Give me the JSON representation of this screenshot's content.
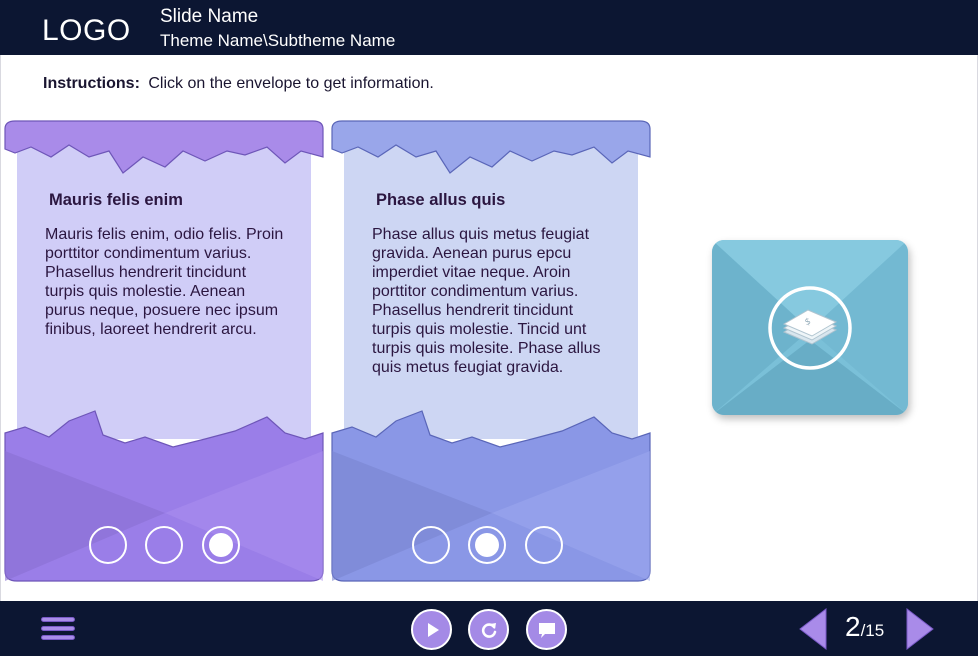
{
  "header": {
    "logo": "LOGO",
    "slide_name": "Slide Name",
    "theme_name": "Theme Name\\Subtheme Name"
  },
  "instructions": {
    "label": "Instructions:",
    "text": "Click on the envelope to get information."
  },
  "cards": [
    {
      "title": "Mauris felis enim",
      "body": "Mauris felis enim, odio felis. Proin porttitor condimentum varius. Phasellus hendrerit tincidunt turpis quis molestie. Aenean purus neque, posuere nec ipsum finibus, laoreet hendrerit arcu.",
      "active_dot": 3,
      "colors": {
        "paper": "#d0cdf7",
        "front": "#9a7ee8",
        "front_dark": "#8a70d2",
        "flap": "#a98be9"
      }
    },
    {
      "title": "Phase allus quis",
      "body": "Phase allus quis metus feugiat gravida. Aenean purus epcu imperdiet vitae neque. Aroin porttitor condimentum varius. Phasellus hendrerit tincidunt turpis quis molestie. Tincid unt turpis quis molesite. Phase allus quis metus feugiat gravida.",
      "active_dot": 2,
      "colors": {
        "paper": "#cdd6f3",
        "front": "#8a97e6",
        "front_dark": "#7a86d0",
        "flap": "#99a6ea"
      }
    }
  ],
  "closed_envelope": {
    "icon": "money-stack-icon",
    "color": "#7ac0d8"
  },
  "footer": {
    "menu_icon": "hamburger-menu-icon",
    "play_icon": "play-icon",
    "replay_icon": "replay-icon",
    "chat_icon": "speech-bubble-icon",
    "page_current": "2",
    "page_total": "/15",
    "accent": "#a48ae6"
  }
}
